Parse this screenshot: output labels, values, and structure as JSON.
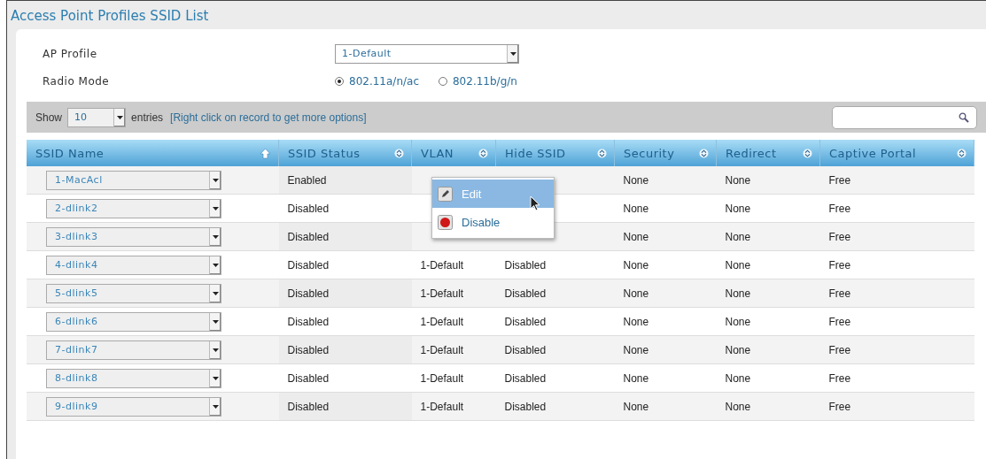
{
  "title": "Access Point Profiles SSID List",
  "form": {
    "ap_profile": {
      "label": "AP Profile",
      "value": "1-Default"
    },
    "radio_mode": {
      "label": "Radio Mode",
      "options": [
        {
          "label": "802.11a/n/ac",
          "selected": true
        },
        {
          "label": "802.11b/g/n",
          "selected": false
        }
      ]
    }
  },
  "toolbar": {
    "show_label": "Show",
    "page_size": "10",
    "entries_label": "entries",
    "hint": "[Right click on record to get more options]"
  },
  "table": {
    "columns": [
      {
        "label": "SSID Name",
        "sorted": true
      },
      {
        "label": "SSID Status",
        "sorted": false
      },
      {
        "label": "VLAN",
        "sorted": false
      },
      {
        "label": "Hide SSID",
        "sorted": false
      },
      {
        "label": "Security",
        "sorted": false
      },
      {
        "label": "Redirect",
        "sorted": false
      },
      {
        "label": "Captive Portal",
        "sorted": false
      }
    ],
    "rows": [
      {
        "ssid": "1-MacAcl",
        "status": "Enabled",
        "security": "None",
        "redirect": "None",
        "portal": "Free"
      },
      {
        "ssid": "2-dlink2",
        "status": "Disabled",
        "security": "None",
        "redirect": "None",
        "portal": "Free"
      },
      {
        "ssid": "3-dlink3",
        "status": "Disabled",
        "security": "None",
        "redirect": "None",
        "portal": "Free"
      },
      {
        "ssid": "4-dlink4",
        "status": "Disabled",
        "vlan": "1-Default",
        "hide": "Disabled",
        "security": "None",
        "redirect": "None",
        "portal": "Free"
      },
      {
        "ssid": "5-dlink5",
        "status": "Disabled",
        "vlan": "1-Default",
        "hide": "Disabled",
        "security": "None",
        "redirect": "None",
        "portal": "Free"
      },
      {
        "ssid": "6-dlink6",
        "status": "Disabled",
        "vlan": "1-Default",
        "hide": "Disabled",
        "security": "None",
        "redirect": "None",
        "portal": "Free"
      },
      {
        "ssid": "7-dlink7",
        "status": "Disabled",
        "vlan": "1-Default",
        "hide": "Disabled",
        "security": "None",
        "redirect": "None",
        "portal": "Free"
      },
      {
        "ssid": "8-dlink8",
        "status": "Disabled",
        "vlan": "1-Default",
        "hide": "Disabled",
        "security": "None",
        "redirect": "None",
        "portal": "Free"
      },
      {
        "ssid": "9-dlink9",
        "status": "Disabled",
        "vlan": "1-Default",
        "hide": "Disabled",
        "security": "None",
        "redirect": "None",
        "portal": "Free"
      }
    ]
  },
  "context_menu": {
    "items": [
      {
        "label": "Edit",
        "kind": "edit",
        "selected": true
      },
      {
        "label": "Disable",
        "kind": "disable",
        "selected": false
      }
    ]
  }
}
